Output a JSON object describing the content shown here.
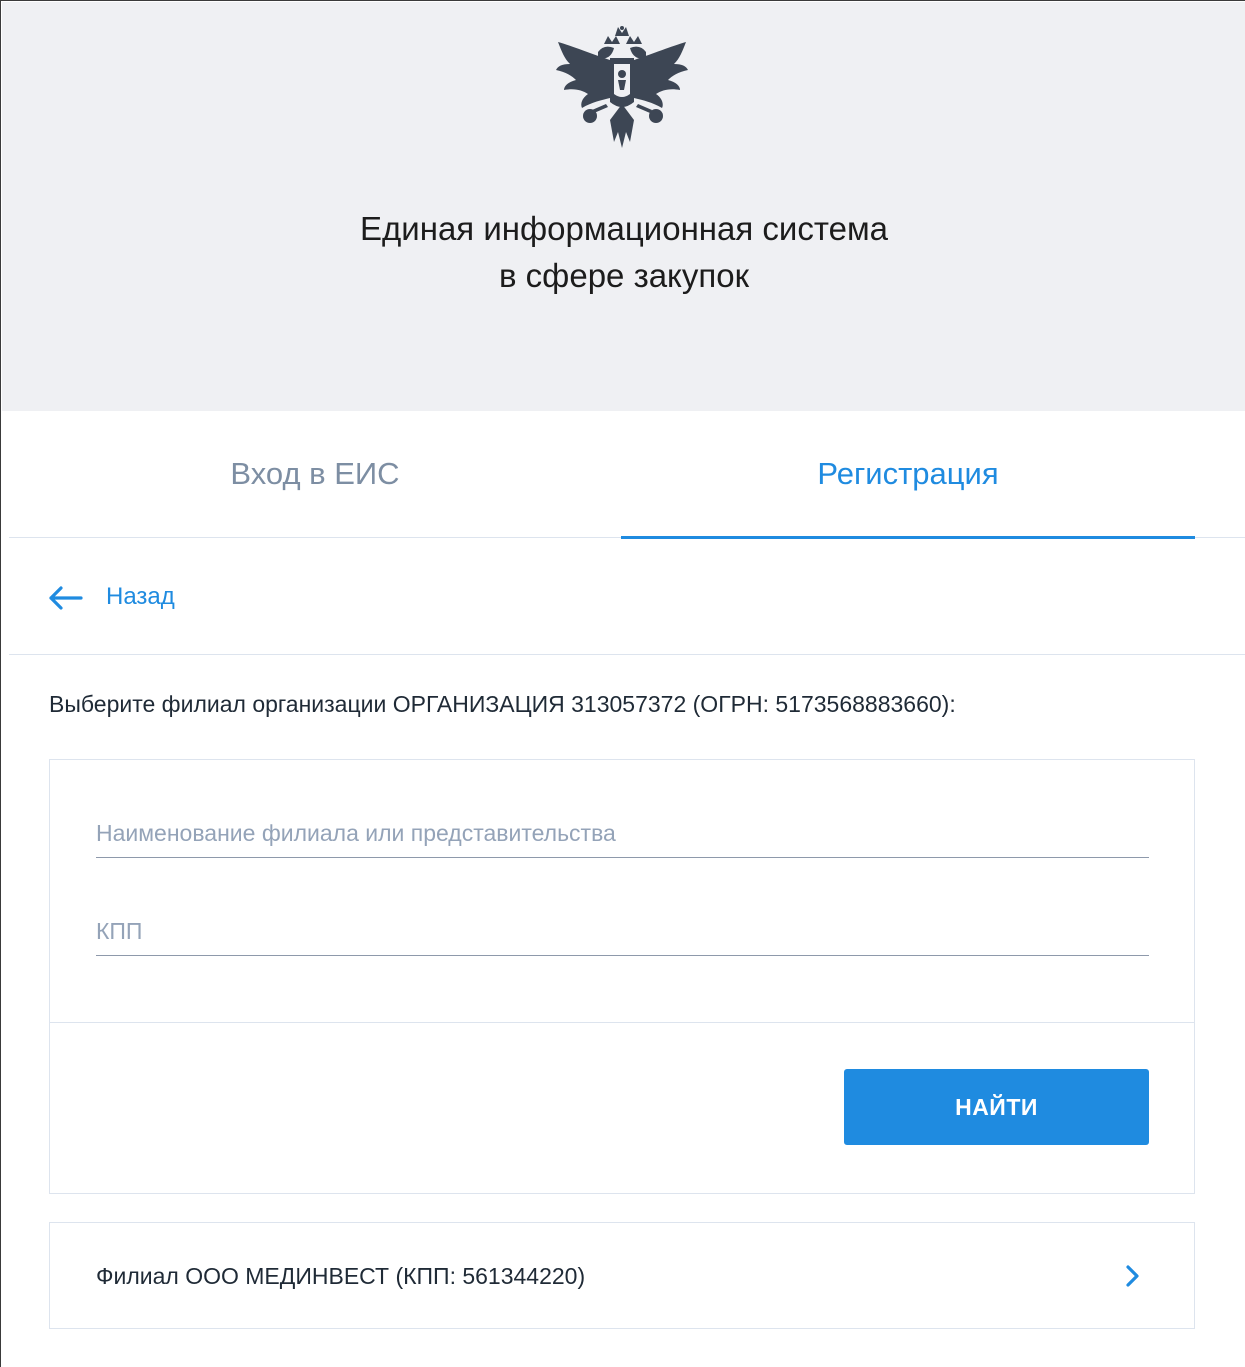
{
  "header": {
    "title_line1": "Единая информационная система",
    "title_line2": "в сфере закупок",
    "emblem_icon": "coat-of-arms-icon"
  },
  "tabs": [
    {
      "label": "Вход в ЕИС",
      "active": false
    },
    {
      "label": "Регистрация",
      "active": true
    }
  ],
  "nav": {
    "back_label": "Назад",
    "back_icon": "arrow-left-icon"
  },
  "instruction": "Выберите филиал организации ОРГАНИЗАЦИЯ 313057372 (ОГРН: 5173568883660):",
  "form": {
    "name_field": {
      "placeholder": "Наименование филиала или представительства",
      "value": ""
    },
    "kpp_field": {
      "placeholder": "КПП",
      "value": ""
    },
    "find_button": "НАЙТИ"
  },
  "results": [
    {
      "label": "Филиал ООО МЕДИНВЕСТ (КПП: 561344220)",
      "icon": "chevron-right-icon"
    }
  ],
  "colors": {
    "accent": "#1f8be0",
    "header_bg": "#eff0f3",
    "muted_text": "#7d8ea3",
    "border": "#dde4ee",
    "emblem": "#3d4654"
  }
}
